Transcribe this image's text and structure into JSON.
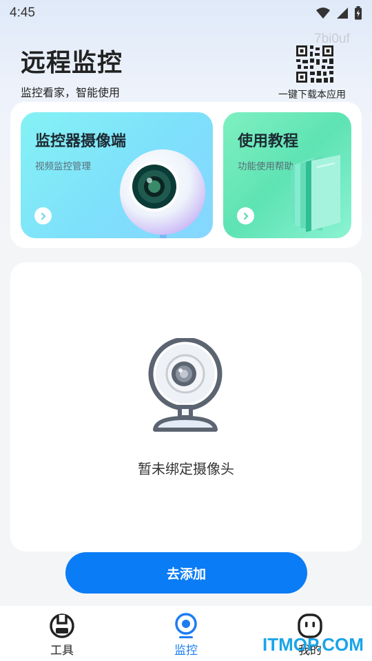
{
  "status_bar": {
    "time": "4:45"
  },
  "watermark_top": "7bi0uf",
  "header": {
    "title": "远程监控",
    "subtitle": "监控看家，智能使用",
    "qr_label": "一键下载本应用"
  },
  "cards": {
    "camera": {
      "title": "监控器摄像端",
      "subtitle": "视频监控管理"
    },
    "tutorial": {
      "title": "使用教程",
      "subtitle": "功能使用帮助"
    }
  },
  "empty_state": {
    "message": "暂未绑定摄像头"
  },
  "add_button": {
    "label": "去添加"
  },
  "bottom_nav": {
    "items": [
      {
        "label": "工具",
        "icon": "toolbox-icon",
        "active": false
      },
      {
        "label": "监控",
        "icon": "camera-icon",
        "active": true
      },
      {
        "label": "我的",
        "icon": "profile-icon",
        "active": false
      }
    ]
  },
  "watermark_bottom": "ITMOP.COM",
  "colors": {
    "accent": "#0a7cf6",
    "nav_active": "#1d7cf2",
    "camera_card": "#7ee0fb",
    "tutorial_card": "#5ee3b4"
  }
}
